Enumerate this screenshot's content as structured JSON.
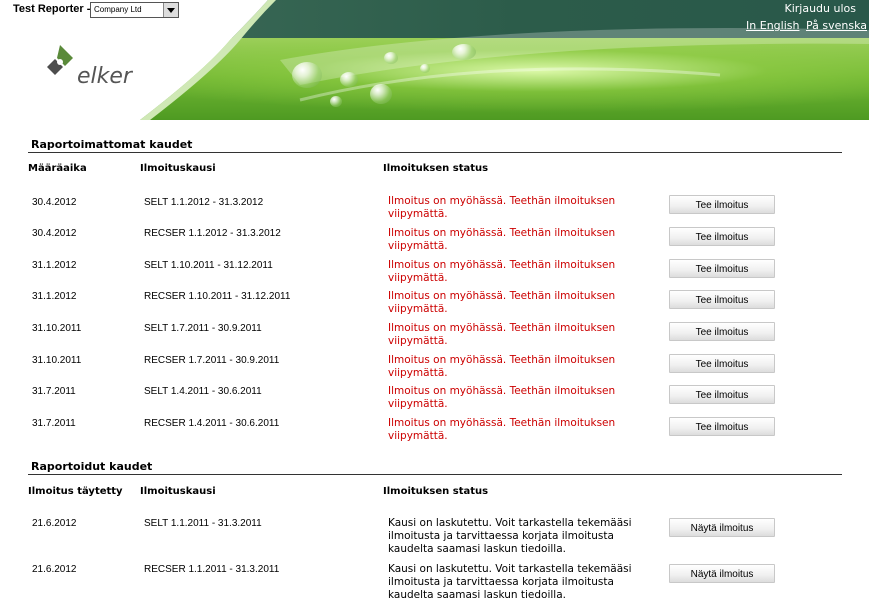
{
  "header": {
    "reporter_label": "Test Reporter -",
    "company_value": "Company Ltd",
    "logout": "Kirjaudu ulos",
    "lang_en": "In English",
    "lang_sv": "På svenska",
    "logo_text": "elker"
  },
  "unreported": {
    "title": "Raportoimattomat kaudet",
    "col_deadline": "Määräaika",
    "col_period": "Ilmoituskausi",
    "col_status": "Ilmoituksen status",
    "rows": [
      {
        "deadline": "30.4.2012",
        "period": "SELT 1.1.2012 - 31.3.2012",
        "status": "Ilmoitus on myöhässä. Teethän ilmoituksen viipymättä.",
        "action": "Tee ilmoitus"
      },
      {
        "deadline": "30.4.2012",
        "period": "RECSER 1.1.2012 - 31.3.2012",
        "status": "Ilmoitus on myöhässä. Teethän ilmoituksen viipymättä.",
        "action": "Tee ilmoitus"
      },
      {
        "deadline": "31.1.2012",
        "period": "SELT 1.10.2011 - 31.12.2011",
        "status": "Ilmoitus on myöhässä. Teethän ilmoituksen viipymättä.",
        "action": "Tee ilmoitus"
      },
      {
        "deadline": "31.1.2012",
        "period": "RECSER 1.10.2011 - 31.12.2011",
        "status": "Ilmoitus on myöhässä. Teethän ilmoituksen viipymättä.",
        "action": "Tee ilmoitus"
      },
      {
        "deadline": "31.10.2011",
        "period": "SELT 1.7.2011 - 30.9.2011",
        "status": "Ilmoitus on myöhässä. Teethän ilmoituksen viipymättä.",
        "action": "Tee ilmoitus"
      },
      {
        "deadline": "31.10.2011",
        "period": "RECSER 1.7.2011 - 30.9.2011",
        "status": "Ilmoitus on myöhässä. Teethän ilmoituksen viipymättä.",
        "action": "Tee ilmoitus"
      },
      {
        "deadline": "31.7.2011",
        "period": "SELT 1.4.2011 - 30.6.2011",
        "status": "Ilmoitus on myöhässä. Teethän ilmoituksen viipymättä.",
        "action": "Tee ilmoitus"
      },
      {
        "deadline": "31.7.2011",
        "period": "RECSER 1.4.2011 - 30.6.2011",
        "status": "Ilmoitus on myöhässä. Teethän ilmoituksen viipymättä.",
        "action": "Tee ilmoitus"
      }
    ]
  },
  "reported": {
    "title": "Raportoidut kaudet",
    "col_filled": "Ilmoitus täytetty",
    "col_period": "Ilmoituskausi",
    "col_status": "Ilmoituksen status",
    "rows": [
      {
        "filled": "21.6.2012",
        "period": "SELT 1.1.2011 - 31.3.2011",
        "status": "Kausi on laskutettu. Voit tarkastella tekemääsi ilmoitusta ja tarvittaessa korjata ilmoitusta kaudelta saamasi laskun tiedoilla.",
        "action": "Näytä ilmoitus"
      },
      {
        "filled": "21.6.2012",
        "period": "RECSER 1.1.2011 - 31.3.2011",
        "status": "Kausi on laskutettu. Voit tarkastella tekemääsi ilmoitusta ja tarvittaessa korjata ilmoitusta kaudelta saamasi laskun tiedoilla.",
        "action": "Näytä ilmoitus"
      }
    ]
  }
}
